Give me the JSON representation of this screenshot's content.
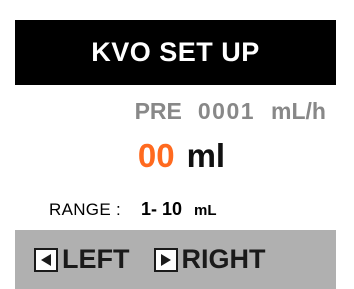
{
  "header": {
    "title": "KVO SET UP"
  },
  "preset": {
    "label": "PRE",
    "value": "0001",
    "unit": "mL/h"
  },
  "volume": {
    "value": "00",
    "unit": "ml"
  },
  "range": {
    "label": "RANGE :",
    "value": "1- 10",
    "unit": "mL"
  },
  "nav": {
    "left_label": "LEFT",
    "right_label": "RIGHT",
    "left_icon": "arrow-left-icon",
    "right_icon": "arrow-right-icon"
  },
  "colors": {
    "title_bg": "#000000",
    "title_text": "#ffffff",
    "preset_text": "#888888",
    "volume_value": "#ff6a1f",
    "nav_bg": "#b0b0b0"
  }
}
